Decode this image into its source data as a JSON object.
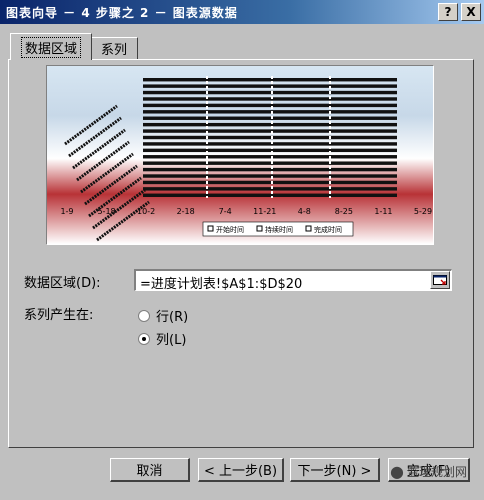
{
  "window": {
    "title": "图表向导 － 4 步骤之 2 － 图表源数据",
    "help_glyph": "?",
    "close_glyph": "X"
  },
  "tabs": [
    {
      "label": "数据区域",
      "active": true
    },
    {
      "label": "系列",
      "active": false
    }
  ],
  "preview": {
    "x_ticks": [
      "1-9",
      "5-18",
      "10-2",
      "2-18",
      "7-4",
      "11-21",
      "4-8",
      "8-25",
      "1-11",
      "5-29"
    ],
    "legend": [
      "开始时间",
      "持续时间",
      "完成时间"
    ],
    "colors": {
      "bar": "#111111",
      "grid": "#000000"
    }
  },
  "form": {
    "data_range_label": "数据区域(D):",
    "data_range_value": "=进度计划表!$A$1:$D$20",
    "series_in_label": "系列产生在:",
    "rows_label": "行(R)",
    "columns_label": "列(L)",
    "selected": "columns"
  },
  "buttons": {
    "cancel": "取消",
    "back": "< 上一步(B)",
    "next": "下一步(N) >",
    "finish": "完成(F)"
  },
  "watermark": {
    "text": "监理规划网"
  }
}
